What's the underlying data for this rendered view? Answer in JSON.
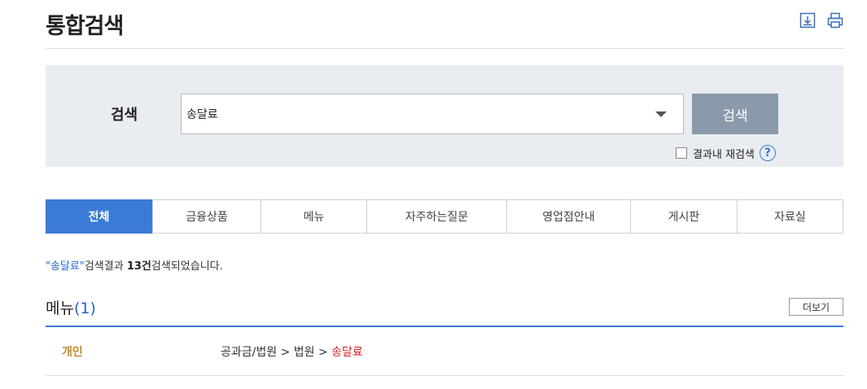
{
  "header": {
    "title": "통합검색"
  },
  "search": {
    "label": "검색",
    "value": "송달료",
    "button_label": "검색",
    "research_label": "결과내 재검색",
    "help_symbol": "?"
  },
  "tabs": [
    {
      "label": "전체",
      "active": true
    },
    {
      "label": "금융상품",
      "active": false
    },
    {
      "label": "메뉴",
      "active": false
    },
    {
      "label": "자주하는질문",
      "active": false
    },
    {
      "label": "영업점안내",
      "active": false
    },
    {
      "label": "게시판",
      "active": false
    },
    {
      "label": "자료실",
      "active": false
    }
  ],
  "summary": {
    "keyword": "\"송달료\"",
    "text1": "검색결과 ",
    "count": "13건",
    "text2": "검색되었습니다."
  },
  "section": {
    "title": "메뉴",
    "count": "(1)",
    "more_label": "더보기"
  },
  "results": [
    {
      "category": "개인",
      "path": "공과금/법원 > 법원 > ",
      "highlight": "송달료"
    }
  ],
  "colors": {
    "accent": "#3a7bd5",
    "search_button": "#8a9aab",
    "panel_bg": "#e9edf1",
    "category": "#c7862a",
    "highlight": "#d42020"
  }
}
